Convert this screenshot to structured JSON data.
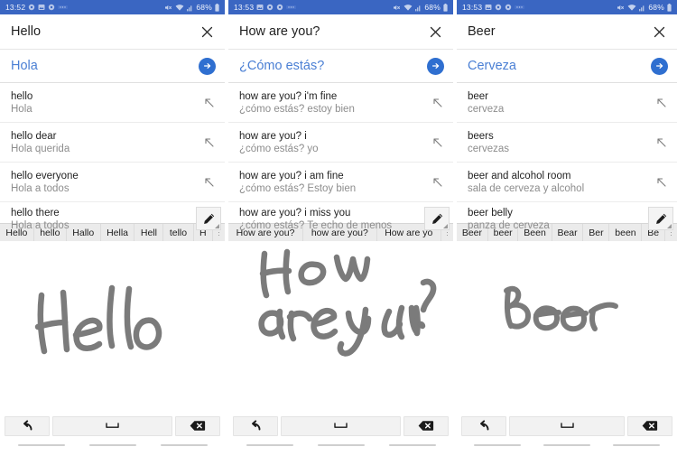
{
  "app": {
    "accent_blue": "#3a66c2",
    "translation_color": "#4a7fd4",
    "ink_color": "#7b7b7b"
  },
  "panels": [
    {
      "status": {
        "clock": "13:52",
        "battery": "68%",
        "icons_left": [
          "gear-icon",
          "image-icon",
          "gear-icon",
          "more-icon"
        ],
        "icons_right": [
          "mute-icon",
          "wifi-icon",
          "signal-icon",
          "battery-icon"
        ]
      },
      "source": {
        "text": "Hello",
        "close_label": "×"
      },
      "translation": {
        "text": "Hola"
      },
      "suggestions": [
        {
          "en": "hello",
          "es": "Hola"
        },
        {
          "en": "hello dear",
          "es": "Hola querida"
        },
        {
          "en": "hello everyone",
          "es": "Hola a todos"
        },
        {
          "en": "hello there",
          "es": "Hola a todos"
        }
      ],
      "candidates": [
        "Hello",
        "hello",
        "Hallo",
        "Hella",
        "Hell",
        "tello",
        "H"
      ],
      "handwriting": {
        "text": "Hello"
      },
      "keyboard": {
        "undo": "undo-icon",
        "space": "space-icon",
        "delete": "backspace-icon"
      }
    },
    {
      "status": {
        "clock": "13:53",
        "battery": "68%",
        "icons_left": [
          "image-icon",
          "gear-icon",
          "gear-icon",
          "more-icon"
        ],
        "icons_right": [
          "mute-icon",
          "wifi-icon",
          "signal-icon",
          "battery-icon"
        ]
      },
      "source": {
        "text": "How are you?",
        "close_label": "×"
      },
      "translation": {
        "text": "¿Cómo estás?"
      },
      "suggestions": [
        {
          "en": "how are you? i'm fine",
          "es": "¿cómo estás? estoy bien"
        },
        {
          "en": "how are you? i",
          "es": "¿cómo estás? yo"
        },
        {
          "en": "how are you? i am fine",
          "es": "¿cómo estás? Estoy bien"
        },
        {
          "en": "how are you? i miss you",
          "es": "¿cómo estás? Te echo de menos"
        }
      ],
      "candidates": [
        "How are you?",
        "how are you?",
        "How are yo"
      ],
      "handwriting": {
        "text": "How are you?"
      },
      "keyboard": {
        "undo": "undo-icon",
        "space": "space-icon",
        "delete": "backspace-icon"
      }
    },
    {
      "status": {
        "clock": "13:53",
        "battery": "68%",
        "icons_left": [
          "image-icon",
          "gear-icon",
          "gear-icon",
          "more-icon"
        ],
        "icons_right": [
          "mute-icon",
          "wifi-icon",
          "signal-icon",
          "battery-icon"
        ]
      },
      "source": {
        "text": "Beer",
        "close_label": "×"
      },
      "translation": {
        "text": "Cerveza"
      },
      "suggestions": [
        {
          "en": "beer",
          "es": "cerveza"
        },
        {
          "en": "beers",
          "es": "cervezas"
        },
        {
          "en": "beer and alcohol room",
          "es": "sala de cerveza y alcohol"
        },
        {
          "en": "beer belly",
          "es": "panza de cerveza"
        }
      ],
      "candidates": [
        "Beer",
        "beer",
        "Been",
        "Bear",
        "Ber",
        "been",
        "Be"
      ],
      "handwriting": {
        "text": "Beer"
      },
      "keyboard": {
        "undo": "undo-icon",
        "space": "space-icon",
        "delete": "backspace-icon"
      }
    }
  ]
}
